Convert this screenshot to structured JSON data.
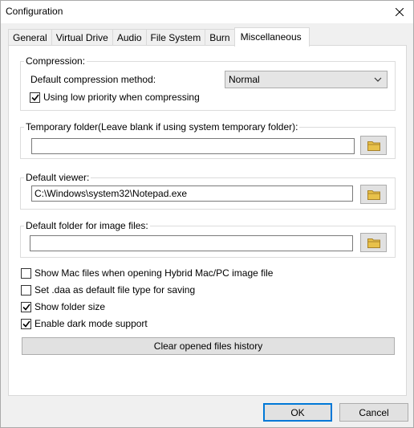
{
  "window": {
    "title": "Configuration"
  },
  "tabs": [
    "General",
    "Virtual Drive",
    "Audio",
    "File System",
    "Burn",
    "Miscellaneous"
  ],
  "compression": {
    "group_label": "Compression:",
    "method_label": "Default compression method:",
    "method_value": "Normal",
    "low_priority_label": "Using low priority when compressing",
    "low_priority_checked": true
  },
  "temp_folder": {
    "group_label": "Temporary folder(Leave blank if using system temporary folder):",
    "value": ""
  },
  "viewer": {
    "group_label": "Default viewer:",
    "value": "C:\\Windows\\system32\\Notepad.exe"
  },
  "image_folder": {
    "group_label": "Default folder for image files:",
    "value": ""
  },
  "options": [
    {
      "label": "Show Mac files when opening Hybrid Mac/PC image file",
      "checked": false
    },
    {
      "label": "Set .daa as default file type for saving",
      "checked": false
    },
    {
      "label": "Show folder size",
      "checked": true
    },
    {
      "label": "Enable dark mode support",
      "checked": true
    }
  ],
  "clear_history_label": "Clear opened files history",
  "buttons": {
    "ok": "OK",
    "cancel": "Cancel"
  },
  "colors": {
    "folder_icon": "#e8c14a",
    "focus_border": "#0078d7"
  }
}
